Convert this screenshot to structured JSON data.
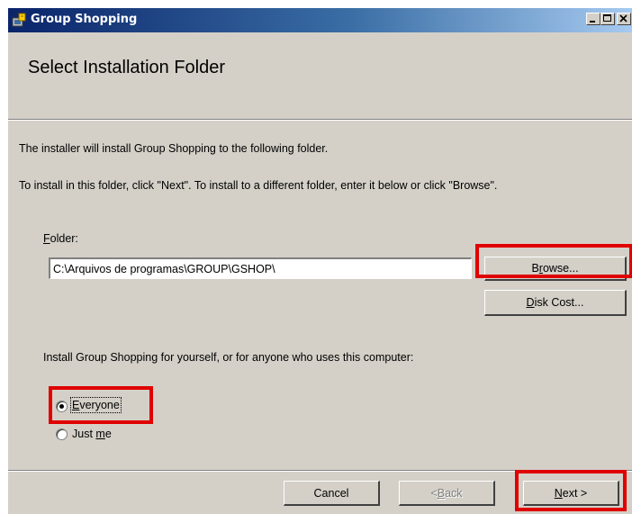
{
  "window": {
    "title": "Group Shopping",
    "controls": {
      "minimize": "_",
      "maximize": "□",
      "close": "X"
    }
  },
  "header": {
    "heading": "Select Installation Folder"
  },
  "body": {
    "intro": "The installer will install Group Shopping to the following folder.",
    "instructions": "To install in this folder, click \"Next\". To install to a different folder, enter it below or click \"Browse\".",
    "folder_label_mnemonic": "F",
    "folder_label_rest": "older:",
    "folder_value": "C:\\Arquivos de programas\\GROUP\\GSHOP\\",
    "browse_label_pre": "B",
    "browse_label_mnemonic": "r",
    "browse_label_post": "owse...",
    "disk_cost_mnemonic": "D",
    "disk_cost_rest": "isk Cost...",
    "install_for_text": "Install Group Shopping for yourself, or for anyone who uses this computer:",
    "options": [
      {
        "mnemonic": "E",
        "rest": "veryone",
        "selected": true
      },
      {
        "pre": "Just ",
        "mnemonic": "m",
        "rest": "e",
        "selected": false
      }
    ]
  },
  "footer": {
    "cancel_label": "Cancel",
    "back_pre": "< ",
    "back_mnemonic": "B",
    "back_rest": "ack",
    "next_mnemonic": "N",
    "next_rest": "ext >"
  },
  "colors": {
    "highlight": "#e00000",
    "titlebar": "#0a246a",
    "face": "#d4d0c8"
  }
}
